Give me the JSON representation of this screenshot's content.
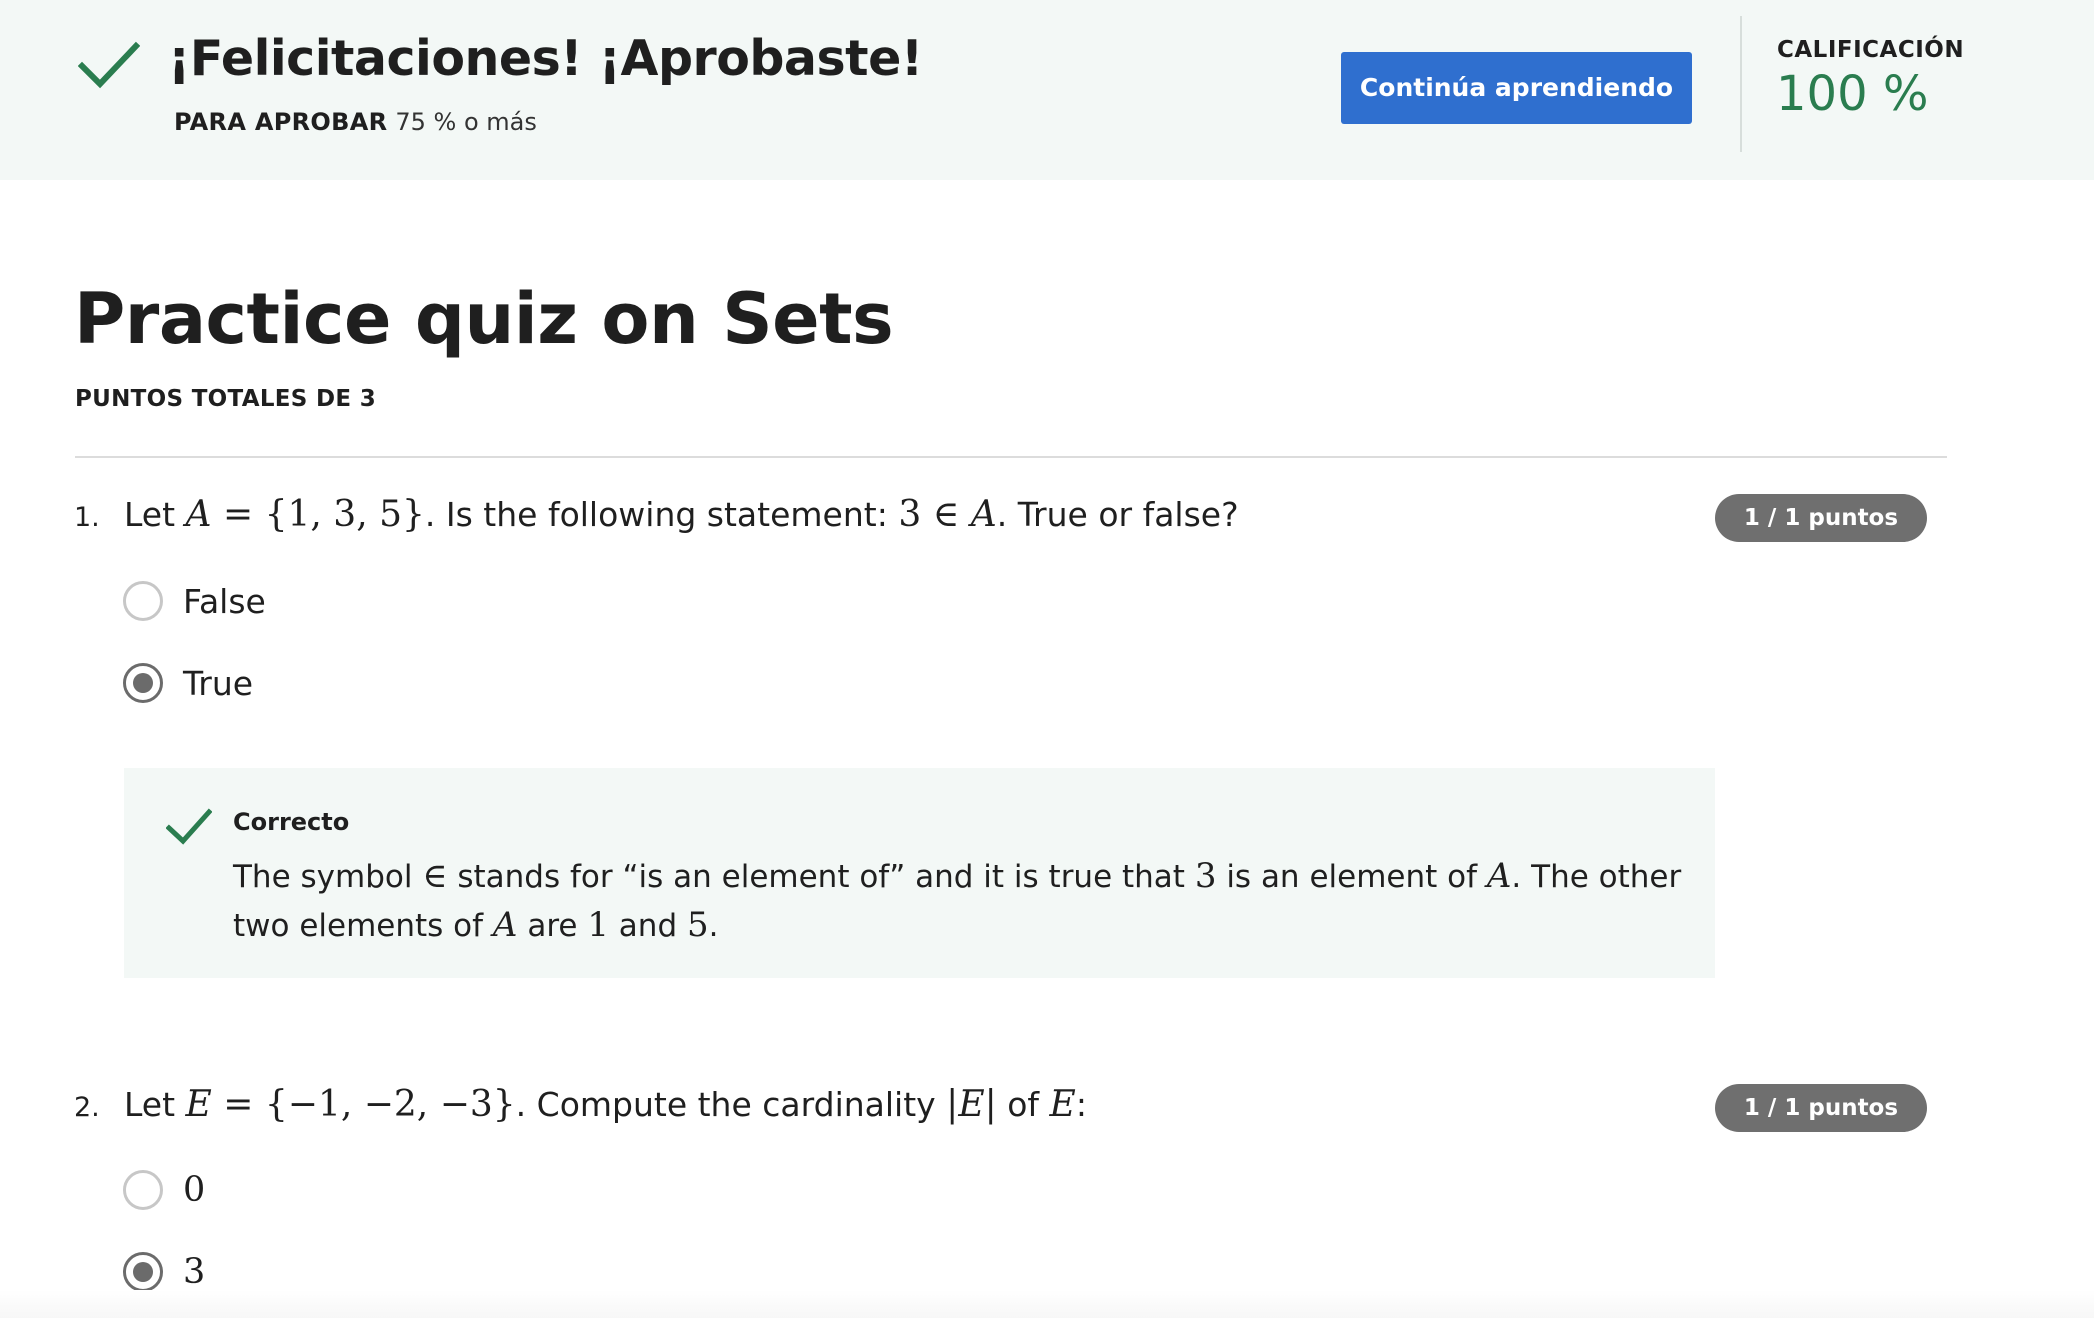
{
  "banner": {
    "title": "¡Felicitaciones! ¡Aprobaste!",
    "pass_label": "PARA APROBAR",
    "pass_value": "75 % o más",
    "continue_label": "Continúa aprendiendo",
    "grade_label": "CALIFICACIÓN",
    "grade_value": "100 %",
    "icon": "check-icon",
    "accent_color": "#2a7d4f",
    "button_color": "#2f6fcf"
  },
  "quiz": {
    "title": "Practice quiz on Sets",
    "total_points": "PUNTOS TOTALES DE 3"
  },
  "questions": [
    {
      "number": "1.",
      "text": {
        "p1": "Let ",
        "m1": "A",
        "m2": " = {1, 3, 5}",
        "p2": ". Is the following statement: ",
        "m3": "3 ∈ ",
        "m4": "A",
        "p3": ". True or false?"
      },
      "points": "1 / 1 puntos",
      "options": [
        {
          "label": "False",
          "selected": false
        },
        {
          "label": "True",
          "selected": true
        }
      ],
      "feedback": {
        "title": "Correcto",
        "t1": "The symbol ",
        "m1": "∈",
        "t2": " stands for “is an element of” and it is true that ",
        "m2": "3",
        "t3": " is an element of ",
        "m3": "A",
        "t4": ". The other two elements of ",
        "m4": "A",
        "t5": " are ",
        "m5": "1",
        "t6": " and ",
        "m6": "5",
        "t7": "."
      }
    },
    {
      "number": "2.",
      "text": {
        "p1": "Let ",
        "m1": "E",
        "m2": " = {−1, −2, −3}",
        "p2": ". Compute the cardinality ",
        "m3": "|",
        "m4": "E",
        "m5": "|",
        "p3": " of ",
        "m6": "E",
        "p4": ":"
      },
      "points": "1 / 1 puntos",
      "options": [
        {
          "label": "0",
          "selected": false
        },
        {
          "label": "3",
          "selected": true
        }
      ]
    }
  ]
}
